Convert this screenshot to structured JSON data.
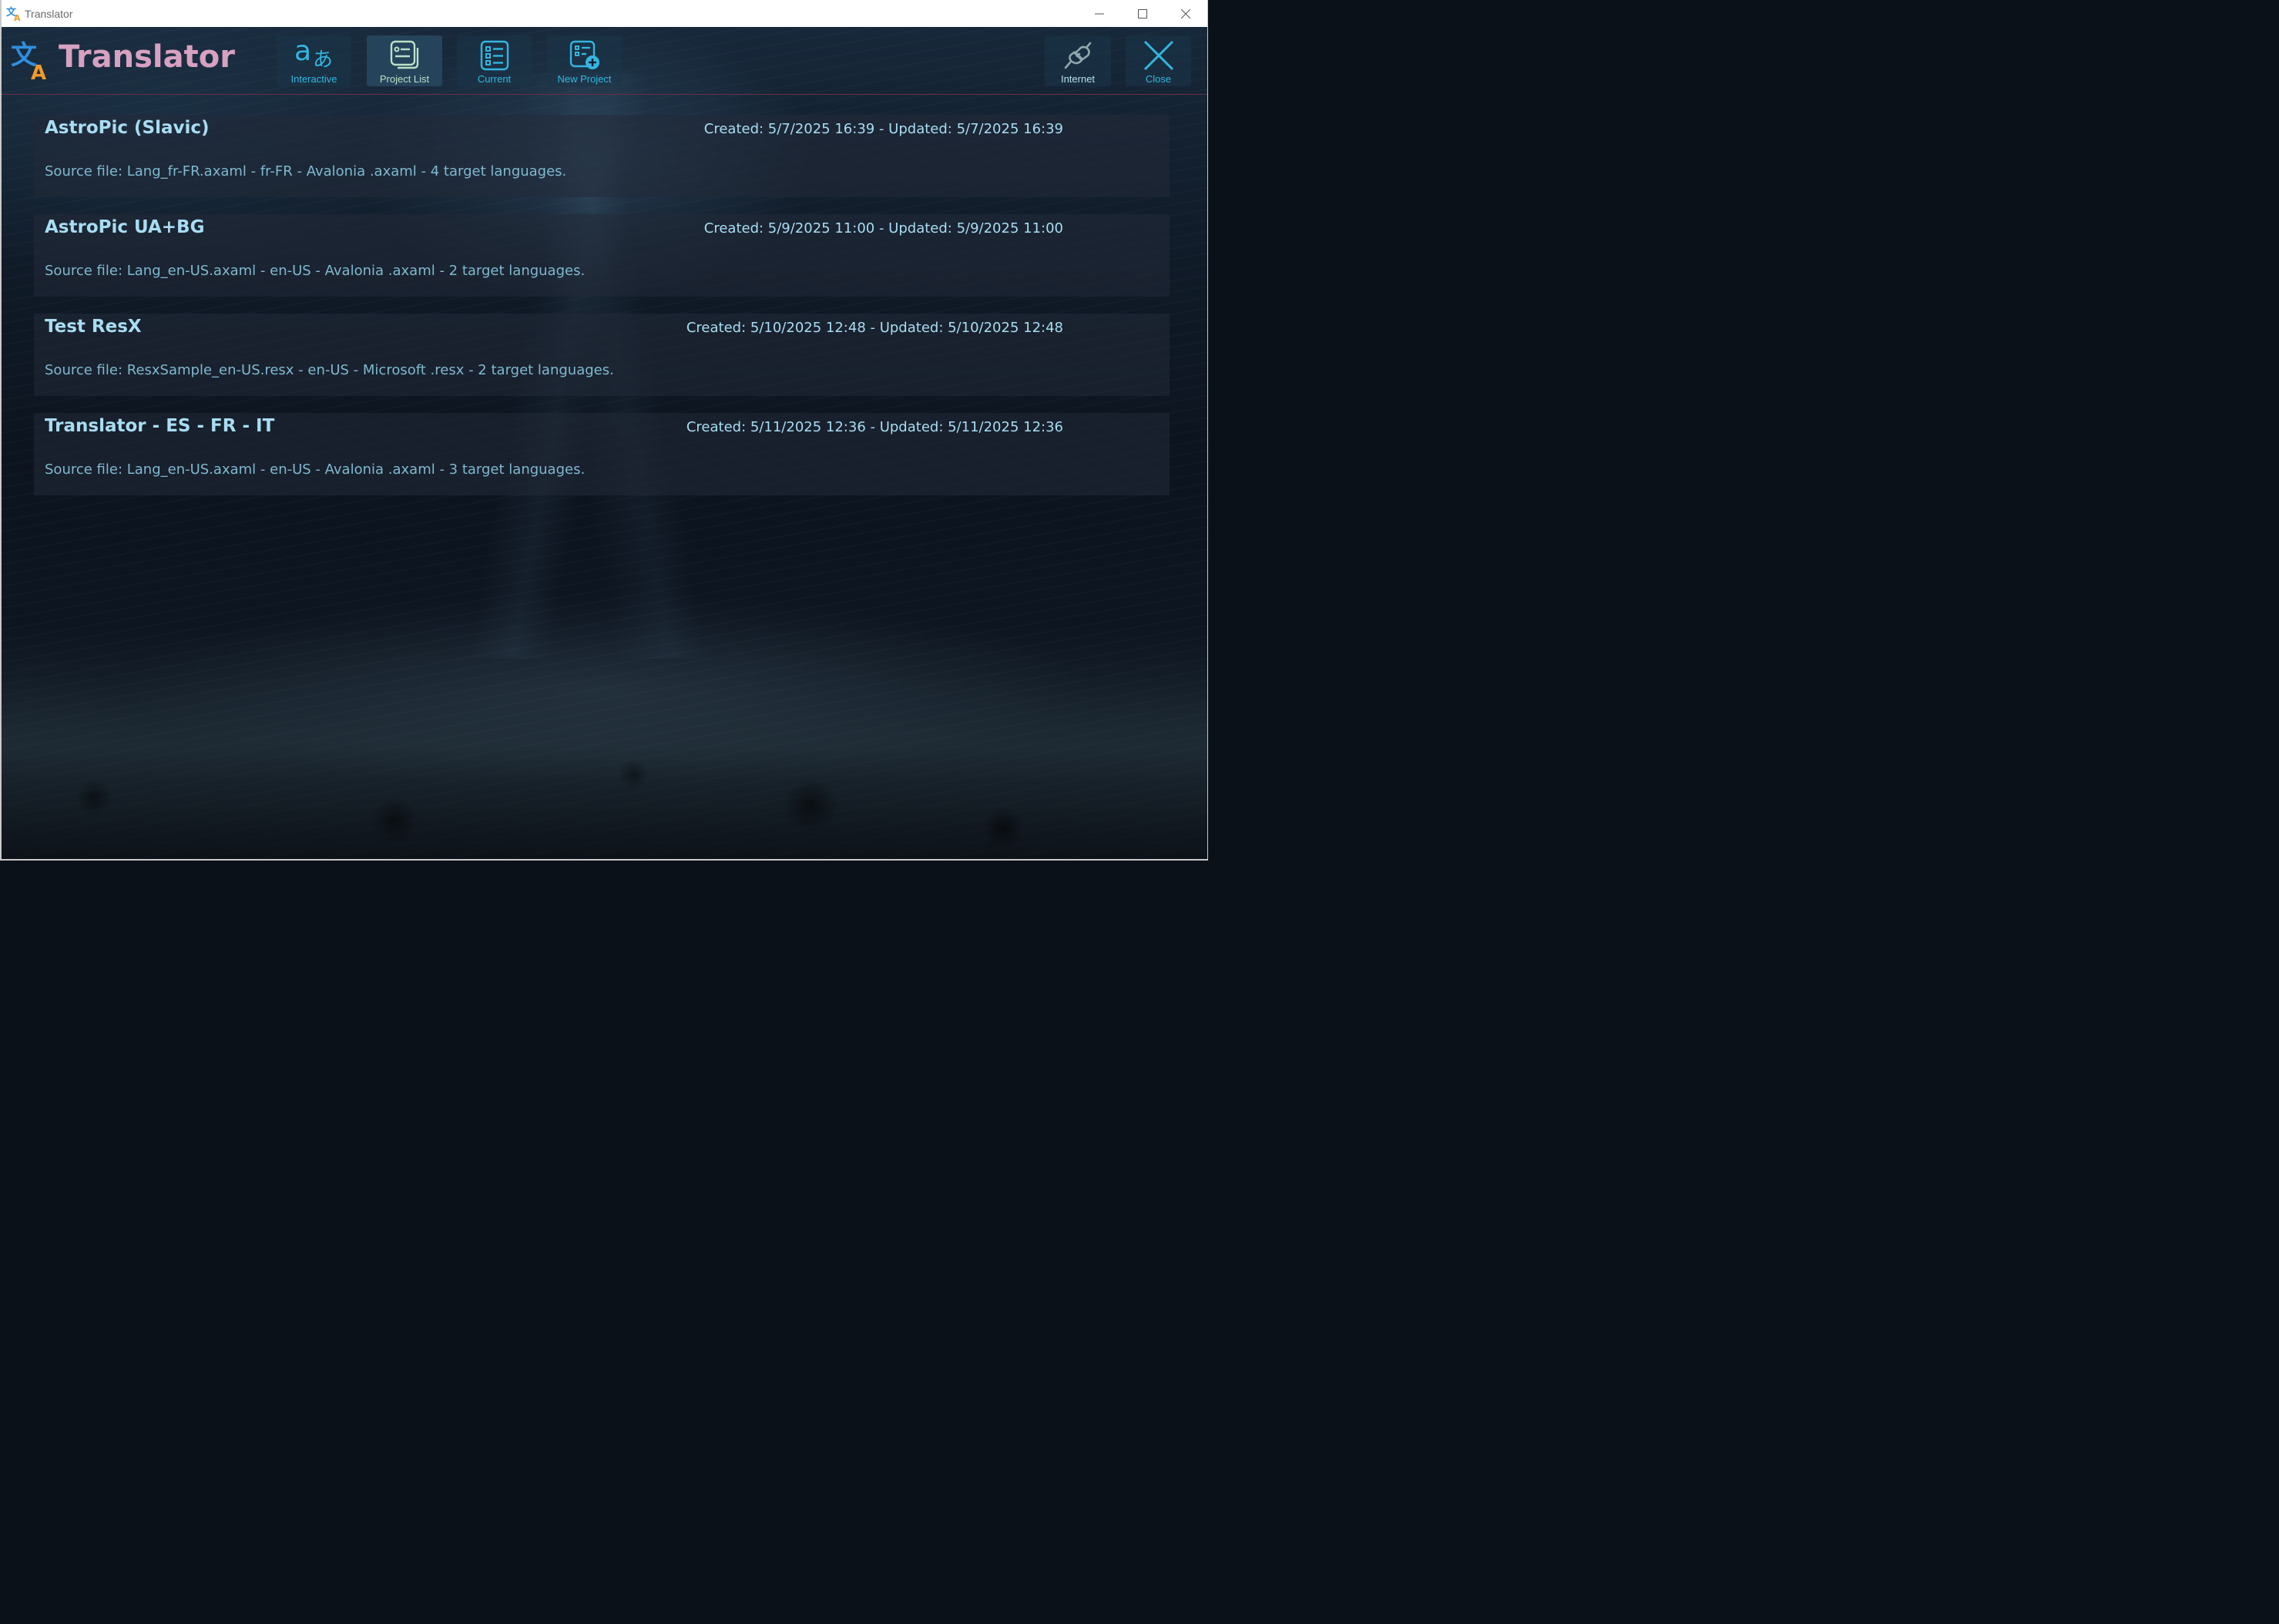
{
  "window": {
    "title": "Translator",
    "controls": [
      "minimize",
      "maximize",
      "close"
    ]
  },
  "header": {
    "app_name": "Translator",
    "toolbar": [
      {
        "key": "interactive",
        "label": "Interactive",
        "icon": "translate-icon",
        "active": false
      },
      {
        "key": "project_list",
        "label": "Project List",
        "icon": "project-list-icon",
        "active": true
      },
      {
        "key": "current",
        "label": "Current",
        "icon": "current-project-icon",
        "active": false
      },
      {
        "key": "new_project",
        "label": "New Project",
        "icon": "new-project-icon",
        "active": false
      }
    ],
    "right_toolbar": [
      {
        "key": "internet",
        "label": "Internet",
        "icon": "plug-icon"
      },
      {
        "key": "close",
        "label": "Close",
        "icon": "close-icon"
      }
    ]
  },
  "projects": [
    {
      "name": "AstroPic (Slavic)",
      "dates": "Created: 5/7/2025 16:39 - Updated: 5/7/2025 16:39",
      "source": "Source file: Lang_fr-FR.axaml - fr-FR - Avalonia  .axaml - 4 target languages."
    },
    {
      "name": "AstroPic UA+BG",
      "dates": "Created: 5/9/2025 11:00 - Updated: 5/9/2025 11:00",
      "source": "Source file: Lang_en-US.axaml - en-US - Avalonia  .axaml - 2 target languages."
    },
    {
      "name": "Test ResX",
      "dates": "Created: 5/10/2025 12:48 - Updated: 5/10/2025 12:48",
      "source": "Source file: ResxSample_en-US.resx - en-US - Microsoft  .resx - 2 target languages."
    },
    {
      "name": "Translator - ES - FR - IT",
      "dates": "Created: 5/11/2025 12:36 - Updated: 5/11/2025 12:36",
      "source": "Source file: Lang_en-US.axaml - en-US - Avalonia  .axaml - 3 target languages."
    }
  ],
  "colors": {
    "brand_title": "#d7a1c1",
    "toolbar_label": "#33b6e0",
    "toolbar_label_active": "#b9e0c6",
    "project_name": "#a8ddf2",
    "project_source": "#7fb9cf",
    "header_divider": "#6a2f48",
    "logo_blue": "#2f8fe0",
    "logo_orange": "#f39a2b"
  }
}
